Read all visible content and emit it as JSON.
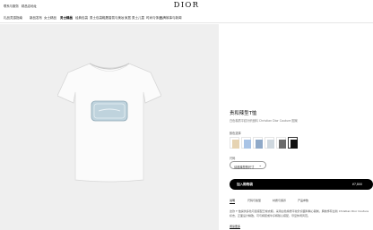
{
  "utility_bar": {
    "contact": "联系与服务",
    "boutique": "精品店地址",
    "logo": "DIOR"
  },
  "nav": {
    "items": [
      "礼品灵感指南",
      "新品发布",
      "女士精品",
      "男士精品",
      "经典包袋",
      "男士包袋鞋履",
      "香氛与美妆",
      "家居",
      "男士儿童",
      "时尚与饰品",
      "品牌故事与新闻"
    ]
  },
  "product": {
    "title": "贵和辣型T恤",
    "subtitle": "白色棉质平纹针织面料 Christian Dior Couture 图案",
    "color_label": "颜色选择",
    "size_label": "尺码",
    "size_value": "请选择您的尺寸",
    "add_to_cart": "加入购物袋",
    "price": "¥7,800"
  },
  "swatches": [
    {
      "color": "#e6d3b2",
      "name": "beige"
    },
    {
      "color": "#a9c4e6",
      "name": "light-blue"
    },
    {
      "color": "#8fa9c8",
      "name": "blue"
    },
    {
      "color": "#cfd8df",
      "name": "pale-blue-grey"
    },
    {
      "color": "#6b6b6b",
      "name": "grey"
    },
    {
      "color": "#111111",
      "name": "black"
    }
  ],
  "details": {
    "tabs": [
      "说明",
      "尺码与版型",
      "材质与保养",
      "产品参数"
    ],
    "description": "这款 T 恤提供多色可选搭配日常衣橱，采用白色棉质平纹针织面料精心裁制，胸前饰有全新 Christian Dior Couture 标志，正面设计精致，可与裤装或牛仔裤随心搭配，尽显休闲风范。",
    "read_more": "阅读更多"
  }
}
